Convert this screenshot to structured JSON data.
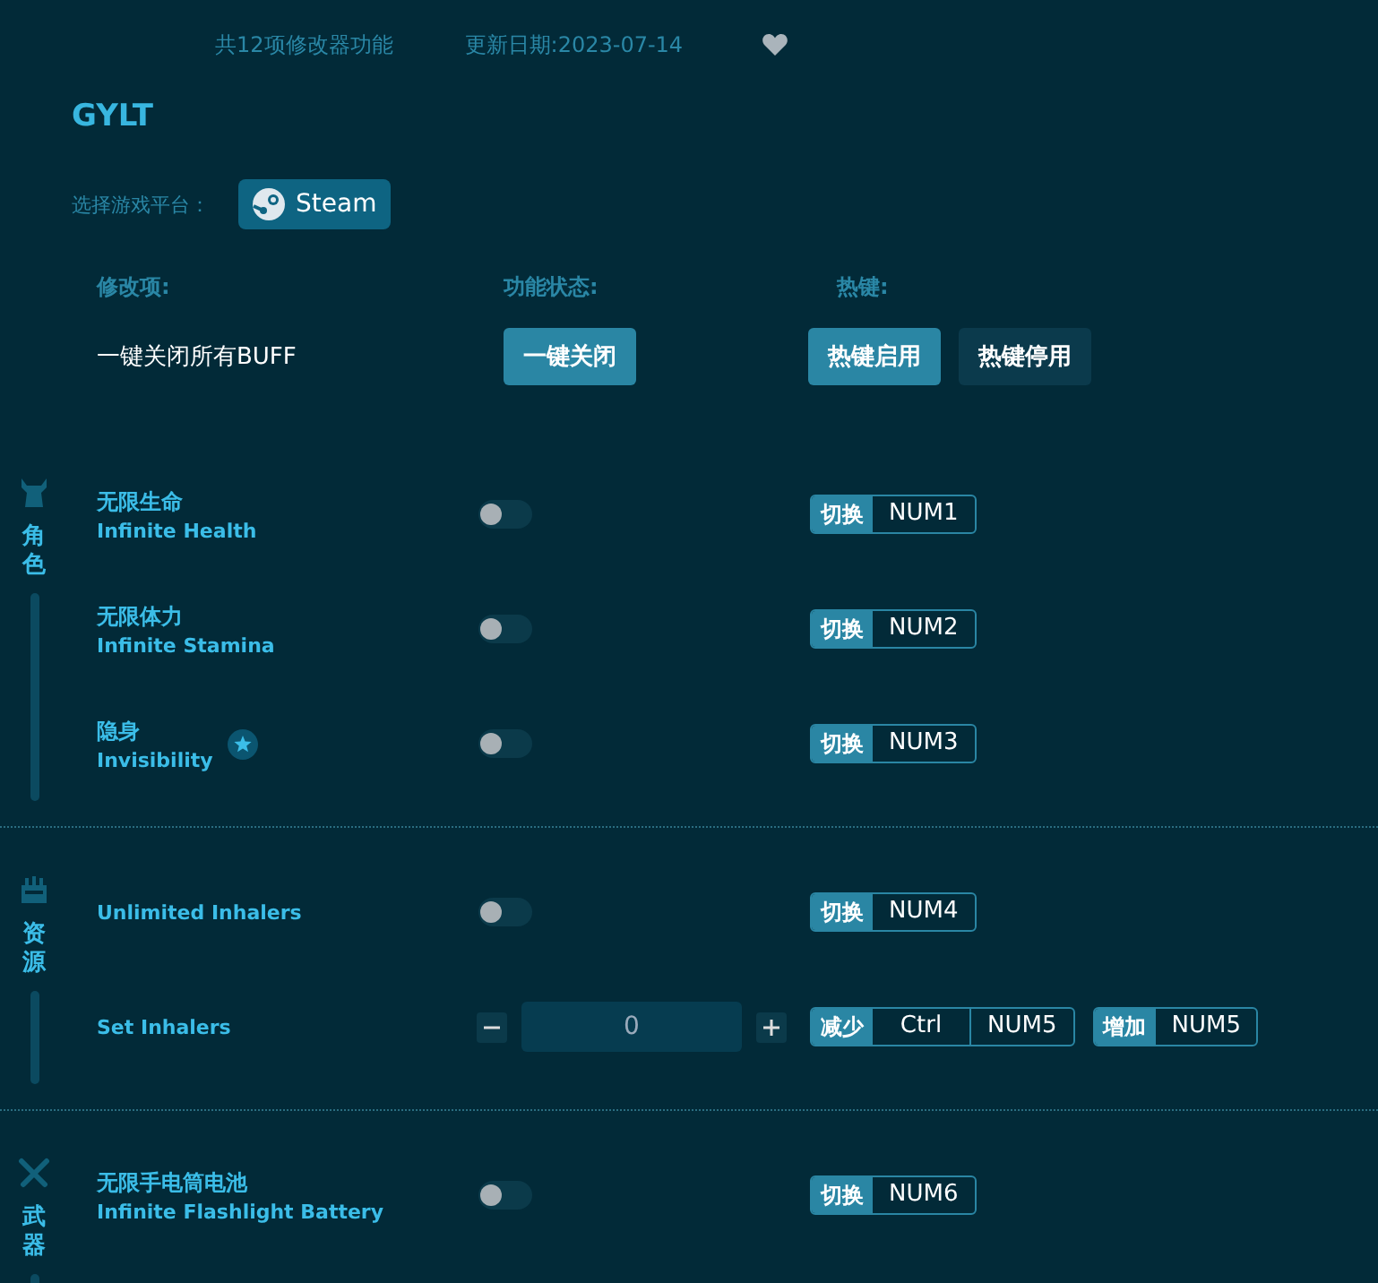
{
  "header": {
    "feature_count": "共12项修改器功能",
    "update_date": "更新日期:2023-07-14",
    "favorited": false
  },
  "game_title": "GYLT",
  "platform": {
    "label": "选择游戏平台：",
    "button": "Steam"
  },
  "columns": [
    "修改项:",
    "功能状态:",
    "热键:"
  ],
  "master": {
    "label": "一键关闭所有BUFF",
    "action": "一键关闭",
    "hotkey_buttons": [
      {
        "label": "热键启用",
        "selected": true
      },
      {
        "label": "热键停用",
        "selected": false
      }
    ]
  },
  "sections": [
    {
      "kind": "character",
      "label": "角色",
      "items": [
        {
          "kind": "toggle",
          "name_cn": "无限生命",
          "name_en": "Infinite Health",
          "starred": false,
          "on": false,
          "hotkeys": [
            {
              "label": "切换",
              "keys": [
                "NUM1"
              ]
            }
          ]
        },
        {
          "kind": "toggle",
          "name_cn": "无限体力",
          "name_en": "Infinite Stamina",
          "starred": false,
          "on": false,
          "hotkeys": [
            {
              "label": "切换",
              "keys": [
                "NUM2"
              ]
            }
          ]
        },
        {
          "kind": "toggle",
          "name_cn": "隐身",
          "name_en": "Invisibility",
          "starred": true,
          "on": false,
          "hotkeys": [
            {
              "label": "切换",
              "keys": [
                "NUM3"
              ]
            }
          ]
        }
      ]
    },
    {
      "kind": "resource",
      "label": "资源",
      "items": [
        {
          "kind": "toggle",
          "name_en": "Unlimited Inhalers",
          "starred": false,
          "on": false,
          "hotkeys": [
            {
              "label": "切换",
              "keys": [
                "NUM4"
              ]
            }
          ]
        },
        {
          "kind": "number",
          "name_en": "Set Inhalers",
          "starred": false,
          "value": "0",
          "hotkeys": [
            {
              "label": "减少",
              "keys": [
                "Ctrl",
                "NUM5"
              ]
            },
            {
              "label": "增加",
              "keys": [
                "NUM5"
              ]
            }
          ]
        }
      ]
    },
    {
      "kind": "weapon",
      "label": "武器",
      "items": [
        {
          "kind": "toggle",
          "name_cn": "无限手电筒电池",
          "name_en": "Infinite Flashlight Battery",
          "starred": false,
          "on": false,
          "hotkeys": [
            {
              "label": "切换",
              "keys": [
                "NUM6"
              ]
            }
          ]
        }
      ]
    }
  ]
}
